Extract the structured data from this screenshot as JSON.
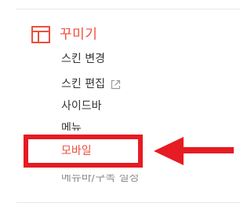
{
  "section": {
    "title": "꾸미기",
    "icon": "layout-icon",
    "accent_color": "#ef4e3e"
  },
  "menu": {
    "items": [
      {
        "label": "스킨 변경"
      },
      {
        "label": "스킨 편집",
        "icon": "external-link-icon"
      },
      {
        "label": "사이드바"
      },
      {
        "label": "메뉴"
      },
      {
        "label": "모바일",
        "selected": true
      },
      {
        "label": "메뉴바/구독 설정"
      }
    ]
  },
  "annotation": {
    "highlight_color": "#e61b23",
    "arrow_color": "#e61b23"
  }
}
